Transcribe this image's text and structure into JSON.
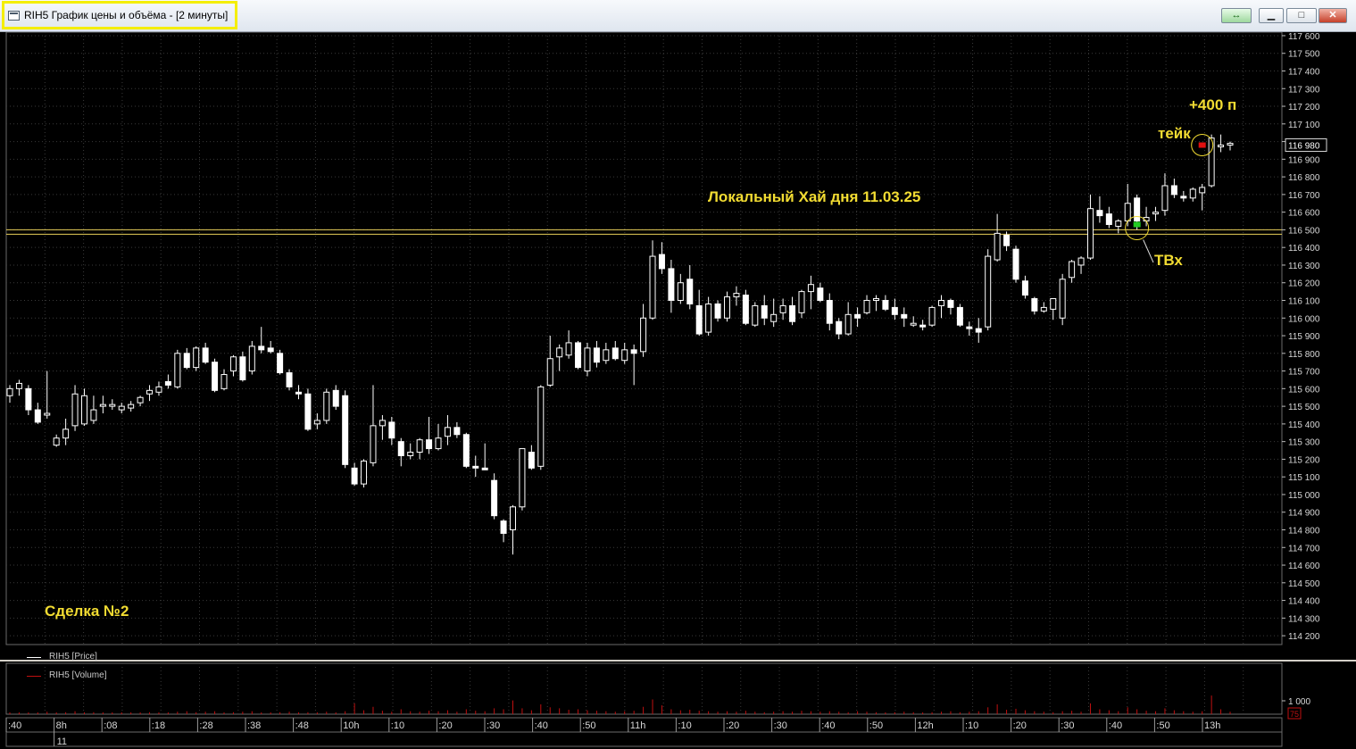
{
  "window": {
    "title": "RIH5 График цены и объёма - [2 минуты]",
    "link_icon": "link-icon",
    "minimize_icon": "minimize-icon",
    "maximize_icon": "maximize-icon",
    "close_icon": "close-icon"
  },
  "annotations": {
    "local_high": "Локальный Хай дня 11.03.25",
    "take": "тейк",
    "points": "+400 п",
    "entry": "ТВх",
    "deal": "Сделка №2"
  },
  "legend": {
    "price": "RIH5 [Price]",
    "volume": "RIH5 [Volume]"
  },
  "colors": {
    "background": "#000000",
    "candle": "#ffffff",
    "level_line": "#e8cf5a",
    "annotation": "#f2dc32",
    "volume": "#c01010",
    "entry_marker": "#22cc22",
    "exit_marker": "#e01010"
  },
  "chart_data": {
    "type": "candlestick",
    "timeframe": "2 минуты",
    "price_axis_ticks": [
      "117 600",
      "117 500",
      "117 400",
      "117 300",
      "117 200",
      "117 100",
      "117 000",
      "116 900",
      "116 800",
      "116 700",
      "116 600",
      "116 500",
      "116 400",
      "116 300",
      "116 200",
      "116 100",
      "116 000",
      "115 900",
      "115 800",
      "115 700",
      "115 600",
      "115 500",
      "115 400",
      "115 300",
      "115 200",
      "115 100",
      "115 000",
      "114 900",
      "114 800",
      "114 700",
      "114 600",
      "114 500",
      "114 400",
      "114 300",
      "114 200"
    ],
    "price_range": [
      114150,
      117620
    ],
    "current_price_label": "116 980",
    "level_prices": [
      116500,
      116475
    ],
    "volume_axis_label": "1 000",
    "volume_current_label": "75",
    "time_axis_labels": [
      ":40",
      "8h",
      ":08",
      ":18",
      ":28",
      ":38",
      ":48",
      "10h",
      ":10",
      ":20",
      ":30",
      ":40",
      ":50",
      "11h",
      ":10",
      ":20",
      ":30",
      ":40",
      ":50",
      "12h",
      ":10",
      ":20",
      ":30",
      ":40",
      ":50",
      "13h"
    ],
    "date_label": "11",
    "entry_price": 116530,
    "exit_price": 116980,
    "candles": [
      [
        115560,
        115620,
        115520,
        115600
      ],
      [
        115600,
        115650,
        115560,
        115630
      ],
      [
        115600,
        115620,
        115450,
        115480
      ],
      [
        115480,
        115520,
        115400,
        115410
      ],
      [
        115450,
        115700,
        115430,
        115460
      ],
      [
        115280,
        115340,
        115270,
        115320
      ],
      [
        115320,
        115430,
        115280,
        115370
      ],
      [
        115390,
        115620,
        115360,
        115570
      ],
      [
        115400,
        115600,
        115390,
        115560
      ],
      [
        115420,
        115560,
        115400,
        115480
      ],
      [
        115500,
        115560,
        115460,
        115510
      ],
      [
        115500,
        115540,
        115480,
        115510
      ],
      [
        115480,
        115520,
        115460,
        115500
      ],
      [
        115490,
        115530,
        115470,
        115510
      ],
      [
        115520,
        115560,
        115500,
        115550
      ],
      [
        115570,
        115620,
        115530,
        115590
      ],
      [
        115580,
        115640,
        115560,
        115610
      ],
      [
        115640,
        115680,
        115600,
        115620
      ],
      [
        115610,
        115820,
        115600,
        115800
      ],
      [
        115800,
        115830,
        115710,
        115720
      ],
      [
        115720,
        115840,
        115700,
        115830
      ],
      [
        115830,
        115860,
        115740,
        115750
      ],
      [
        115750,
        115770,
        115580,
        115590
      ],
      [
        115600,
        115710,
        115590,
        115680
      ],
      [
        115700,
        115790,
        115670,
        115780
      ],
      [
        115780,
        115810,
        115640,
        115650
      ],
      [
        115700,
        115870,
        115680,
        115840
      ],
      [
        115840,
        115950,
        115800,
        115820
      ],
      [
        115830,
        115870,
        115800,
        115810
      ],
      [
        115800,
        115820,
        115680,
        115690
      ],
      [
        115690,
        115710,
        115590,
        115610
      ],
      [
        115580,
        115620,
        115540,
        115570
      ],
      [
        115570,
        115600,
        115360,
        115370
      ],
      [
        115400,
        115460,
        115370,
        115420
      ],
      [
        115420,
        115600,
        115400,
        115580
      ],
      [
        115590,
        115620,
        115480,
        115500
      ],
      [
        115560,
        115590,
        115150,
        115170
      ],
      [
        115150,
        115180,
        115050,
        115060
      ],
      [
        115060,
        115200,
        115040,
        115190
      ],
      [
        115180,
        115620,
        115160,
        115390
      ],
      [
        115390,
        115450,
        115310,
        115420
      ],
      [
        115410,
        115440,
        115280,
        115320
      ],
      [
        115300,
        115320,
        115160,
        115220
      ],
      [
        115220,
        115290,
        115200,
        115240
      ],
      [
        115240,
        115320,
        115200,
        115310
      ],
      [
        115310,
        115440,
        115230,
        115260
      ],
      [
        115260,
        115400,
        115250,
        115320
      ],
      [
        115330,
        115450,
        115280,
        115380
      ],
      [
        115380,
        115410,
        115320,
        115340
      ],
      [
        115340,
        115350,
        115150,
        115160
      ],
      [
        115160,
        115220,
        115100,
        115150
      ],
      [
        115150,
        115290,
        115140,
        115140
      ],
      [
        115080,
        115120,
        114860,
        114880
      ],
      [
        114850,
        114860,
        114730,
        114780
      ],
      [
        114800,
        114940,
        114660,
        114930
      ],
      [
        114930,
        115260,
        114910,
        115260
      ],
      [
        115240,
        115280,
        115140,
        115150
      ],
      [
        115160,
        115620,
        115140,
        115610
      ],
      [
        115620,
        115900,
        115610,
        115770
      ],
      [
        115780,
        115850,
        115700,
        115830
      ],
      [
        115790,
        115930,
        115770,
        115860
      ],
      [
        115860,
        115870,
        115710,
        115720
      ],
      [
        115700,
        115860,
        115670,
        115830
      ],
      [
        115830,
        115870,
        115720,
        115750
      ],
      [
        115760,
        115860,
        115740,
        115820
      ],
      [
        115830,
        115870,
        115760,
        115770
      ],
      [
        115760,
        115860,
        115740,
        115820
      ],
      [
        115820,
        115850,
        115620,
        115800
      ],
      [
        115810,
        116080,
        115780,
        116000
      ],
      [
        116000,
        116440,
        115990,
        116350
      ],
      [
        116360,
        116430,
        116250,
        116280
      ],
      [
        116280,
        116330,
        116030,
        116100
      ],
      [
        116100,
        116250,
        116080,
        116200
      ],
      [
        116220,
        116300,
        116050,
        116080
      ],
      [
        116070,
        116160,
        115900,
        115910
      ],
      [
        115920,
        116120,
        115900,
        116080
      ],
      [
        116080,
        116100,
        115980,
        116000
      ],
      [
        116000,
        116150,
        115980,
        116120
      ],
      [
        116120,
        116180,
        116070,
        116140
      ],
      [
        116130,
        116160,
        115960,
        115970
      ],
      [
        115960,
        116090,
        115950,
        116070
      ],
      [
        116070,
        116130,
        115960,
        116000
      ],
      [
        115980,
        116110,
        115950,
        116020
      ],
      [
        116030,
        116110,
        115990,
        116070
      ],
      [
        116070,
        116120,
        115960,
        115980
      ],
      [
        116030,
        116160,
        116000,
        116150
      ],
      [
        116150,
        116240,
        116050,
        116190
      ],
      [
        116170,
        116200,
        116090,
        116100
      ],
      [
        116100,
        116140,
        115930,
        115970
      ],
      [
        115980,
        116000,
        115880,
        115910
      ],
      [
        115910,
        116090,
        115900,
        116020
      ],
      [
        116020,
        116060,
        115950,
        116000
      ],
      [
        116030,
        116130,
        116020,
        116100
      ],
      [
        116100,
        116130,
        116040,
        116110
      ],
      [
        116100,
        116130,
        116040,
        116050
      ],
      [
        116060,
        116110,
        115990,
        116020
      ],
      [
        116020,
        116060,
        115950,
        116000
      ],
      [
        115960,
        116010,
        115950,
        115970
      ],
      [
        115960,
        115990,
        115930,
        115950
      ],
      [
        115960,
        116070,
        115950,
        116060
      ],
      [
        116070,
        116130,
        116000,
        116100
      ],
      [
        116100,
        116110,
        116020,
        116060
      ],
      [
        116060,
        116080,
        115950,
        115960
      ],
      [
        115950,
        115980,
        115900,
        115940
      ],
      [
        115940,
        116000,
        115860,
        115920
      ],
      [
        115950,
        116390,
        115930,
        116350
      ],
      [
        116330,
        116590,
        116320,
        116480
      ],
      [
        116470,
        116490,
        116380,
        116410
      ],
      [
        116390,
        116410,
        116200,
        116220
      ],
      [
        116210,
        116240,
        116110,
        116130
      ],
      [
        116110,
        116120,
        116020,
        116040
      ],
      [
        116040,
        116090,
        116030,
        116060
      ],
      [
        116050,
        116090,
        115990,
        116110
      ],
      [
        116000,
        116250,
        115960,
        116220
      ],
      [
        116230,
        116330,
        116200,
        116320
      ],
      [
        116300,
        116350,
        116250,
        116340
      ],
      [
        116340,
        116700,
        116330,
        116620
      ],
      [
        116610,
        116690,
        116540,
        116580
      ],
      [
        116590,
        116630,
        116510,
        116530
      ],
      [
        116520,
        116560,
        116480,
        116550
      ],
      [
        116550,
        116760,
        116520,
        116650
      ],
      [
        116680,
        116700,
        116500,
        116550
      ],
      [
        116550,
        116630,
        116520,
        116570
      ],
      [
        116590,
        116630,
        116550,
        116600
      ],
      [
        116610,
        116820,
        116580,
        116750
      ],
      [
        116750,
        116790,
        116680,
        116700
      ],
      [
        116690,
        116720,
        116660,
        116680
      ],
      [
        116680,
        116740,
        116660,
        116730
      ],
      [
        116710,
        116760,
        116610,
        116740
      ],
      [
        116750,
        117040,
        116740,
        117020
      ],
      [
        116970,
        117040,
        116940,
        116980
      ],
      [
        116980,
        117000,
        116950,
        116990
      ]
    ],
    "volumes": [
      0.02,
      0.03,
      0.02,
      0.03,
      0.05,
      0.03,
      0.04,
      0.06,
      0.03,
      0.04,
      0.02,
      0.03,
      0.02,
      0.03,
      0.02,
      0.04,
      0.03,
      0.02,
      0.05,
      0.06,
      0.04,
      0.05,
      0.06,
      0.03,
      0.04,
      0.05,
      0.06,
      0.03,
      0.02,
      0.04,
      0.05,
      0.03,
      0.04,
      0.02,
      0.05,
      0.03,
      0.06,
      0.22,
      0.08,
      0.15,
      0.07,
      0.05,
      0.1,
      0.06,
      0.05,
      0.07,
      0.06,
      0.08,
      0.05,
      0.1,
      0.07,
      0.06,
      0.12,
      0.1,
      0.28,
      0.12,
      0.08,
      0.2,
      0.14,
      0.12,
      0.09,
      0.1,
      0.08,
      0.07,
      0.06,
      0.05,
      0.06,
      0.07,
      0.15,
      0.3,
      0.18,
      0.1,
      0.08,
      0.09,
      0.07,
      0.06,
      0.05,
      0.06,
      0.05,
      0.07,
      0.05,
      0.04,
      0.05,
      0.06,
      0.05,
      0.07,
      0.06,
      0.05,
      0.06,
      0.05,
      0.04,
      0.06,
      0.05,
      0.04,
      0.03,
      0.04,
      0.05,
      0.04,
      0.03,
      0.04,
      0.05,
      0.06,
      0.04,
      0.05,
      0.06,
      0.14,
      0.2,
      0.09,
      0.11,
      0.08,
      0.06,
      0.05,
      0.04,
      0.06,
      0.07,
      0.05,
      0.22,
      0.1,
      0.08,
      0.06,
      0.14,
      0.1,
      0.07,
      0.06,
      0.12,
      0.08,
      0.06,
      0.05,
      0.06,
      0.38,
      0.1,
      0.05
    ]
  }
}
